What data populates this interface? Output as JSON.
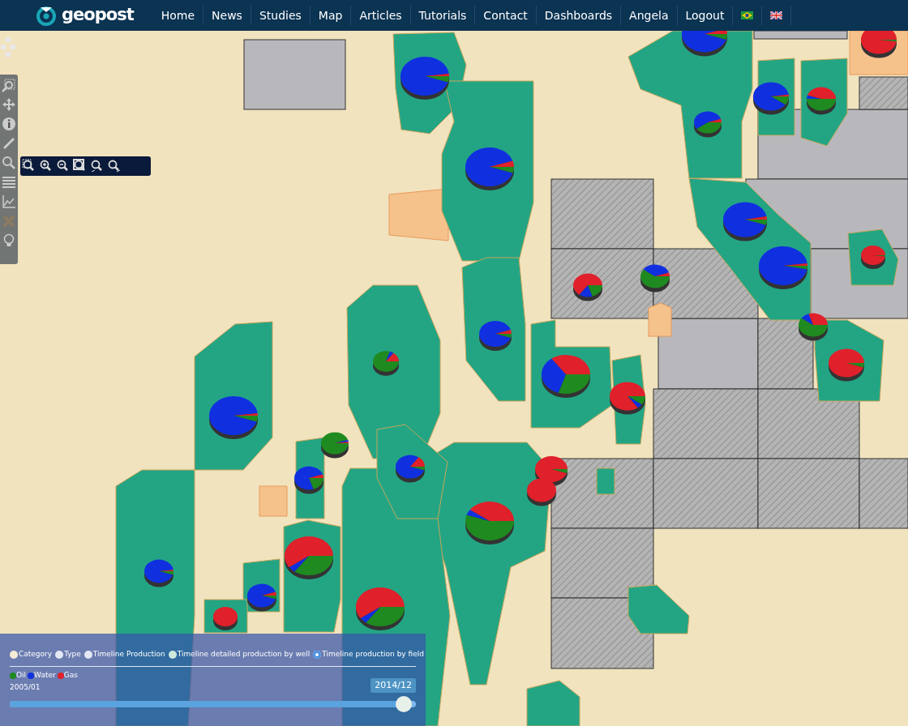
{
  "navbar": {
    "brand": "geopost",
    "items": [
      {
        "label": "Home",
        "selected": false
      },
      {
        "label": "News",
        "selected": false
      },
      {
        "label": "Studies",
        "selected": false
      },
      {
        "label": "Map",
        "selected": false
      },
      {
        "label": "Articles",
        "selected": false
      },
      {
        "label": "Tutorials",
        "selected": false
      },
      {
        "label": "Contact",
        "selected": false
      },
      {
        "label": "Dashboards",
        "selected": false
      },
      {
        "label": "Angela",
        "selected": false
      },
      {
        "label": "Logout",
        "selected": false
      }
    ]
  },
  "layer_panel": {
    "modes": [
      {
        "label": "Category",
        "selected": false,
        "color": "#f5ecd6"
      },
      {
        "label": "Type",
        "selected": false,
        "color": "#e4e8f4"
      },
      {
        "label": "Timeline Production",
        "selected": false,
        "color": "#e4e8f4"
      },
      {
        "label": "Timeline detailed production by well",
        "selected": false,
        "color": "#cde8dc"
      },
      {
        "label": "Timeline production by field",
        "selected": true,
        "color": "#4a90e2"
      }
    ],
    "legend": [
      {
        "label": "Oil",
        "color": "#1f8a1f"
      },
      {
        "label": "Water",
        "color": "#1030e0"
      },
      {
        "label": "Gas",
        "color": "#e0202a"
      }
    ],
    "timeline": {
      "start": "2005/01",
      "end": "2014/12",
      "level": 0.97
    }
  }
}
